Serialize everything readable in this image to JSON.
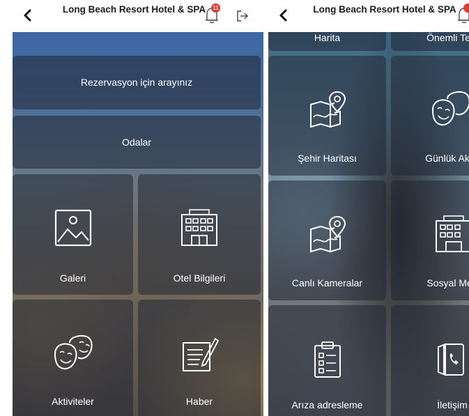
{
  "left": {
    "header": {
      "title": "Long Beach Resort Hotel & SPA",
      "badge_count": "11"
    },
    "menu": {
      "reservation": "Rezervasyon için arayınız",
      "rooms": "Odalar",
      "gallery": "Galeri",
      "hotel_info": "Otel Bilgileri",
      "activities": "Aktiviteler",
      "news": "Haber"
    }
  },
  "right": {
    "header": {
      "title": "Long Beach Resort Hotel & SPA"
    },
    "menu": {
      "map_partial": "Harita",
      "phones_partial": "Önemli Tele",
      "city_map": "Şehir Haritası",
      "daily_activities": "Günlük Aktiv",
      "live_cameras": "Canlı Kameralar",
      "social_media": "Sosyal Med",
      "fault_report": "Arıza adresleme",
      "contact": "İletişim"
    }
  },
  "colors": {
    "badge": "#e5392c",
    "tile": "#202634",
    "icon_stroke": "#ffffff"
  },
  "icons": [
    "back-icon",
    "bell-icon",
    "logout-icon",
    "image-icon",
    "hotel-building-icon",
    "theater-masks-icon",
    "note-pencil-icon",
    "map-pin-icon",
    "clipboard-list-icon",
    "phone-book-icon"
  ]
}
